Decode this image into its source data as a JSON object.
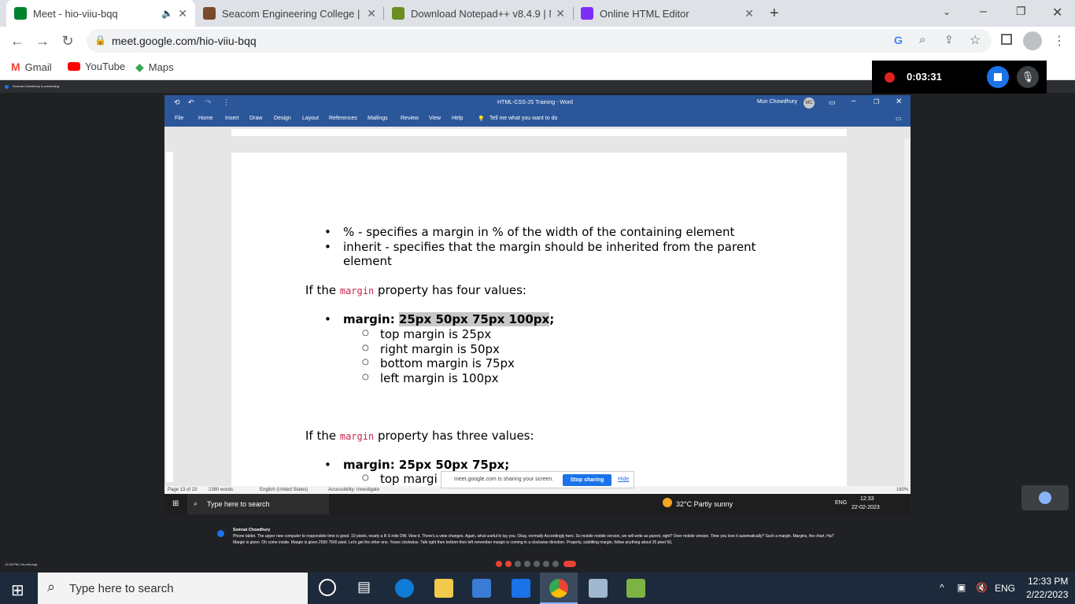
{
  "browser": {
    "tabs": [
      {
        "title": "Meet - hio-viiu-bqq",
        "favicon": "google-meet-icon",
        "color": "#00832d",
        "active": true
      },
      {
        "title": "Seacom Engineering College | Be",
        "favicon": "seacom-icon",
        "color": "#7a4b2a",
        "active": false
      },
      {
        "title": "Download Notepad++ v8.4.9 | N",
        "favicon": "notepad-icon",
        "color": "#6b8e23",
        "active": false
      },
      {
        "title": "Online HTML Editor",
        "favicon": "editor-icon",
        "color": "#7b2ff7",
        "active": false
      }
    ],
    "url": "meet.google.com/hio-viiu-bqq",
    "bookmarks": [
      "Gmail",
      "YouTube",
      "Maps"
    ]
  },
  "recorder": {
    "time": "0:03:31"
  },
  "presenter_label": "Somnat Chowdhury is presenting",
  "word": {
    "title": "HTML-CSS-JS Training  -  Word",
    "user": "Mun Chowdhury",
    "user_initials": "MC",
    "ribbon_tabs": [
      "File",
      "Home",
      "Insert",
      "Draw",
      "Design",
      "Layout",
      "References",
      "Mailings",
      "Review",
      "View",
      "Help"
    ],
    "tell_me": "Tell me what you want to do",
    "status": {
      "page": "Page 13 of 23",
      "words": "2380 words",
      "language": "English (United States)",
      "accessibility": "Accessibility: Investigate",
      "zoom": "160%"
    }
  },
  "document": {
    "bullets_top": [
      "% - specifies a margin in % of the width of the containing element",
      "inherit - specifies that the margin should be inherited from the parent",
      "element"
    ],
    "four_values": {
      "prefix": "If the ",
      "keyword": "margin",
      "suffix": " property has four values:"
    },
    "example4": {
      "label": "margin: ",
      "value": "25px 50px 75px 100px",
      "end": ";"
    },
    "subitems": [
      "top margin is 25px",
      "right margin is 50px",
      "bottom margin is 75px",
      "left margin is 100px"
    ],
    "three_values": {
      "prefix": "If the ",
      "keyword": "margin",
      "suffix": " property has three values:"
    },
    "example3": "margin: 25px 50px 75px;",
    "partial_sub": "top margi"
  },
  "sharebar": {
    "text": "meet.google.com is sharing your screen.",
    "stop": "Stop sharing",
    "hide": "Hide"
  },
  "inner_taskbar": {
    "search": "Type here to search",
    "weather": "32°C  Partly sunny",
    "lang": "ENG",
    "time": "12:33",
    "date": "22-02-2023"
  },
  "captions": {
    "speaker": "Somnat Chowdhury",
    "text": "Phone tablet. The upper new computer to responsible time is good. 10 pixels, nearly a R S mile DW. View it. There's a view changes. Again, what useful to lay you. Okay, normally Accordingly here. So mobile mobile version, we will write as parent, right? Over mobile version. Time you love it automatically? Such a margin. Margins, the chart. Ha? Margin is given. Oh come inside. Margin is given 2550 7500 pixel. Let's get the other one. Yeses clockwise. Talk right then bottom then left remember margin is coming in a clockwise direction. Property, subtitling margin, follow anything about 25 pixel 50,"
  },
  "meet_bottom": {
    "time_label": "12:33 PM  |  hio-viiu-bqq"
  },
  "taskbar": {
    "search": "Type here to search",
    "lang": "ENG",
    "time": "12:33 PM",
    "date": "2/22/2023"
  }
}
